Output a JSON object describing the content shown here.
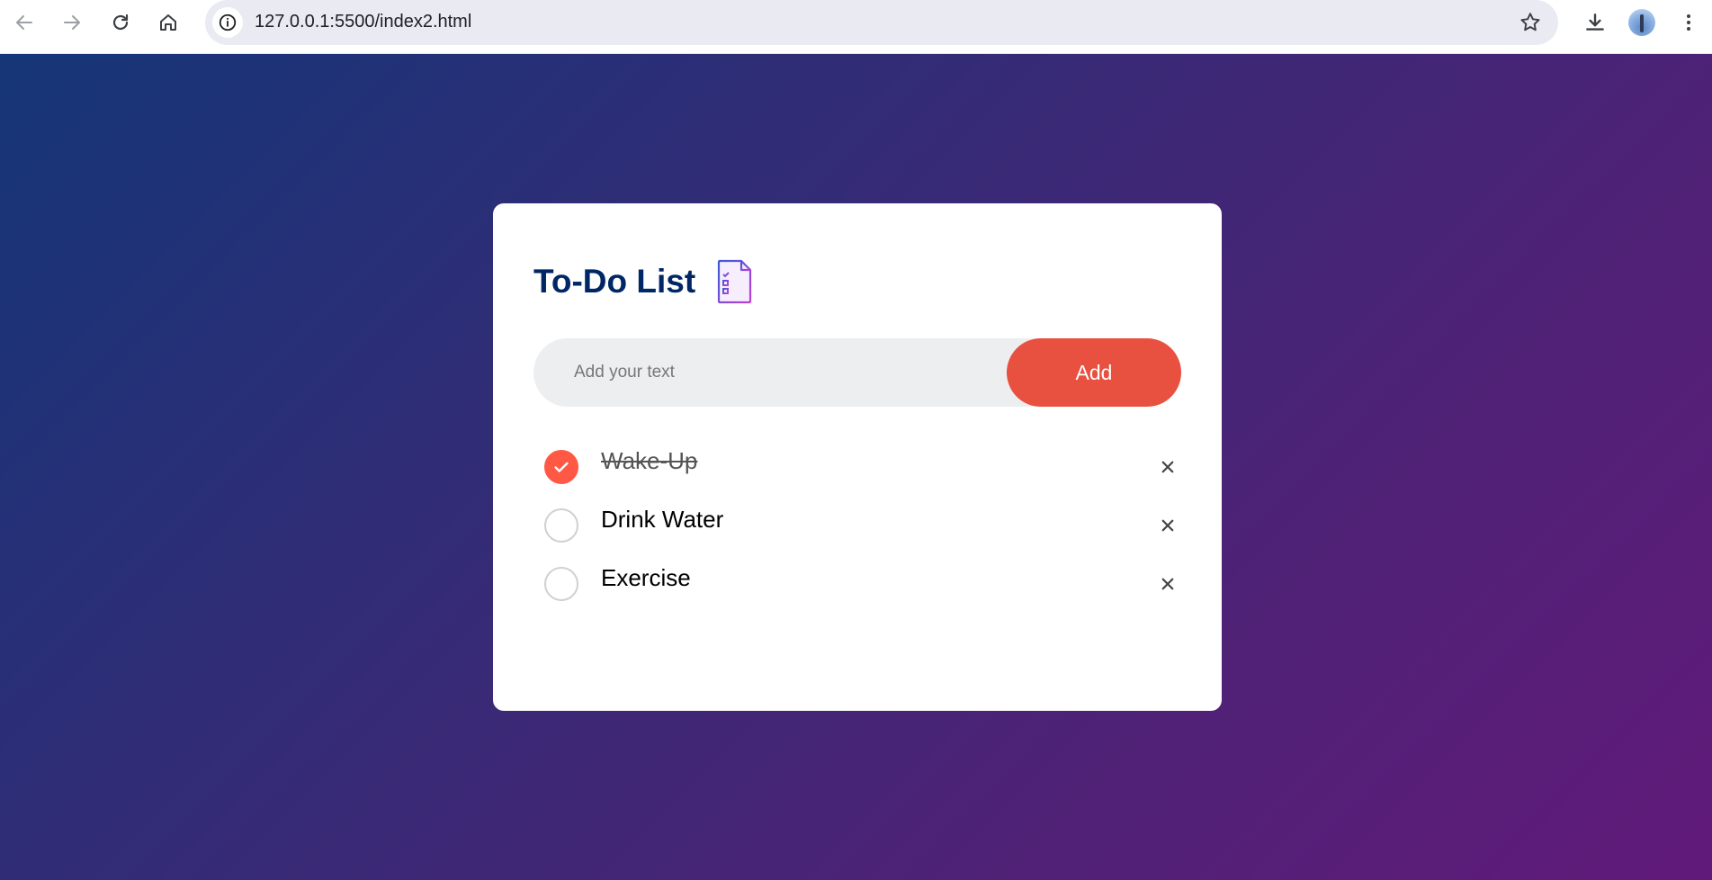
{
  "browser": {
    "url": "127.0.0.1:5500/index2.html",
    "icons": [
      "back-icon",
      "forward-icon",
      "reload-icon",
      "home-icon",
      "site-info-icon",
      "bookmark-star-icon",
      "download-icon",
      "profile-avatar",
      "menu-icon"
    ]
  },
  "app": {
    "title": "To-Do List",
    "title_icon": "checklist-document-icon",
    "input": {
      "placeholder": "Add your text",
      "value": ""
    },
    "add_button": "Add",
    "tasks": [
      {
        "label": "Wake-Up",
        "completed": true
      },
      {
        "label": "Drink Water",
        "completed": false
      },
      {
        "label": "Exercise",
        "completed": false
      }
    ]
  },
  "colors": {
    "background_gradient_start": "#153677",
    "background_gradient_end": "#611a7a",
    "title": "#002765",
    "accent": "#e8503f",
    "check_done": "#ff5945"
  }
}
